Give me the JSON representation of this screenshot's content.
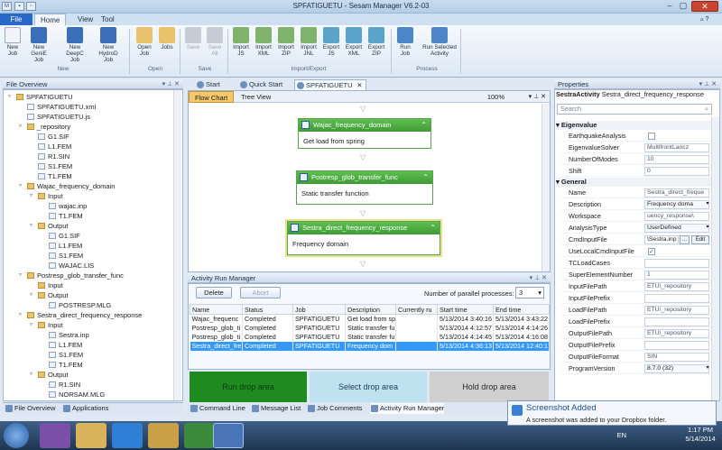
{
  "window": {
    "title": "SPFATIGUETU - Sesam Manager V6.2-03"
  },
  "ribbon_tabs": [
    "File",
    "Home",
    "View",
    "Tool"
  ],
  "ribbon": {
    "new": [
      {
        "l1": "New",
        "l2": "Job"
      },
      {
        "l1": "New",
        "l2": "GeniE Job"
      },
      {
        "l1": "New",
        "l2": "DeepC Job"
      },
      {
        "l1": "New",
        "l2": "HydroD Job"
      }
    ],
    "open": [
      {
        "l1": "Open",
        "l2": "Job"
      },
      {
        "l1": "Jobs",
        "l2": ""
      }
    ],
    "save": [
      {
        "l1": "Save",
        "l2": ""
      },
      {
        "l1": "Save",
        "l2": "All"
      }
    ],
    "impexp": [
      {
        "l1": "Import",
        "l2": "JS"
      },
      {
        "l1": "Import",
        "l2": "XML"
      },
      {
        "l1": "Import",
        "l2": "ZIP"
      },
      {
        "l1": "Import",
        "l2": "JNL"
      },
      {
        "l1": "Export",
        "l2": "JS"
      },
      {
        "l1": "Export",
        "l2": "XML"
      },
      {
        "l1": "Export",
        "l2": "ZIP"
      }
    ],
    "process": [
      {
        "l1": "Run",
        "l2": "Job"
      },
      {
        "l1": "Run Selected",
        "l2": "Activity"
      }
    ],
    "groups": [
      "New",
      "Open",
      "Save",
      "Import/Export",
      "Process"
    ]
  },
  "file_overview": {
    "title": "File Overview",
    "tree": [
      {
        "label": "SPFATIGUETU",
        "kind": "folder",
        "depth": 0,
        "exp": "-"
      },
      {
        "label": "SPFATIGUETU.xml",
        "kind": "file",
        "depth": 1
      },
      {
        "label": "SPFATIGUETU.js",
        "kind": "file",
        "depth": 1
      },
      {
        "label": "_repository",
        "kind": "folder",
        "depth": 1,
        "exp": "-"
      },
      {
        "label": "G1.SIF",
        "kind": "file",
        "depth": 2
      },
      {
        "label": "L1.FEM",
        "kind": "file",
        "depth": 2
      },
      {
        "label": "R1.SIN",
        "kind": "file",
        "depth": 2
      },
      {
        "label": "S1.FEM",
        "kind": "file",
        "depth": 2
      },
      {
        "label": "T1.FEM",
        "kind": "file",
        "depth": 2
      },
      {
        "label": "Wajac_frequency_domain",
        "kind": "folder",
        "depth": 1,
        "exp": "-"
      },
      {
        "label": "Input",
        "kind": "folder",
        "depth": 2,
        "exp": "-"
      },
      {
        "label": "wajac.inp",
        "kind": "file",
        "depth": 3
      },
      {
        "label": "T1.FEM",
        "kind": "file",
        "depth": 3
      },
      {
        "label": "Output",
        "kind": "folder",
        "depth": 2,
        "exp": "-"
      },
      {
        "label": "G1.SIF",
        "kind": "file",
        "depth": 3
      },
      {
        "label": "L1.FEM",
        "kind": "file",
        "depth": 3
      },
      {
        "label": "S1.FEM",
        "kind": "file",
        "depth": 3
      },
      {
        "label": "WAJAC.LIS",
        "kind": "file",
        "depth": 3
      },
      {
        "label": "Postresp_glob_transfer_func",
        "kind": "folder",
        "depth": 1,
        "exp": "-"
      },
      {
        "label": "Input",
        "kind": "folder",
        "depth": 2
      },
      {
        "label": "Output",
        "kind": "folder",
        "depth": 2,
        "exp": "-"
      },
      {
        "label": "POSTRESP.MLG",
        "kind": "file",
        "depth": 3
      },
      {
        "label": "Sestra_direct_frequency_response",
        "kind": "folder",
        "depth": 1,
        "exp": "-"
      },
      {
        "label": "Input",
        "kind": "folder",
        "depth": 2,
        "exp": "-"
      },
      {
        "label": "Sestra.inp",
        "kind": "file",
        "depth": 3
      },
      {
        "label": "L1.FEM",
        "kind": "file",
        "depth": 3
      },
      {
        "label": "S1.FEM",
        "kind": "file",
        "depth": 3
      },
      {
        "label": "T1.FEM",
        "kind": "file",
        "depth": 3
      },
      {
        "label": "Output",
        "kind": "folder",
        "depth": 2,
        "exp": "-"
      },
      {
        "label": "R1.SIN",
        "kind": "file",
        "depth": 3
      },
      {
        "label": "NORSAM.MLG",
        "kind": "file",
        "depth": 3
      }
    ],
    "bottom_tabs": [
      "File Overview",
      "Applications"
    ]
  },
  "doc_tabs": [
    "Start",
    "Quick Start",
    "SPFATIGUETU"
  ],
  "flow": {
    "tabs": [
      "Flow Chart",
      "Tree View"
    ],
    "zoom": "100%",
    "activities": [
      {
        "name": "Wajac_frequency_domain",
        "desc": "Get load from spring"
      },
      {
        "name": "Postresp_glob_transfer_func",
        "desc": "Static transfer function"
      },
      {
        "name": "Sestra_direct_frequency_response",
        "desc": "Frequency domain"
      }
    ]
  },
  "arm": {
    "title": "Activity Run Manager",
    "delete": "Delete",
    "abort": "Abort",
    "parallel_label": "Number of parallel processes:",
    "parallel_value": "3",
    "columns": [
      "Name",
      "Status",
      "Job",
      "Description",
      "Currently ru",
      "Start time",
      "End time"
    ],
    "rows": [
      [
        "Wajac_frequenc",
        "Completed",
        "SPFATIGUETU",
        "Get load from sp",
        "",
        "5/13/2014 3:40:16",
        "5/13/2014 3:43:22"
      ],
      [
        "Postresp_glob_ti",
        "Completed",
        "SPFATIGUETU",
        "Static transfer fu",
        "",
        "5/13/2014 4:12:57",
        "5/13/2014 4:14:26"
      ],
      [
        "Postresp_glob_ti",
        "Completed",
        "SPFATIGUETU",
        "Static transfer fu",
        "",
        "5/13/2014 4:14:45",
        "5/13/2014 4:16:08"
      ],
      [
        "Sestra_direct_fre",
        "Completed",
        "SPFATIGUETU",
        "Frequency dom",
        "",
        "5/13/2014 4:36:13",
        "5/13/2014 12:40:1"
      ]
    ],
    "selected_row": 3,
    "drop": {
      "run": "Run drop area",
      "select": "Select drop area",
      "hold": "Hold drop area"
    },
    "bottom_tabs": [
      "Command Line",
      "Message List",
      "Job Comments",
      "Activity Run Manager"
    ]
  },
  "properties": {
    "title": "Properties",
    "object_type": "SestraActivity",
    "object_name": "Sestra_direct_frequency_response",
    "search_placeholder": "Search",
    "categories": [
      {
        "name": "Eigenvalue",
        "rows": [
          {
            "n": "EarthquakeAnalysis",
            "t": "check",
            "v": ""
          },
          {
            "n": "EigenvalueSolver",
            "t": "val",
            "v": "MultifrontLancz"
          },
          {
            "n": "NumberOfModes",
            "t": "val",
            "v": "10"
          },
          {
            "n": "Shift",
            "t": "val",
            "v": "0"
          }
        ]
      },
      {
        "name": "General",
        "rows": [
          {
            "n": "Name",
            "t": "val",
            "v": "Sestra_direct_freque"
          },
          {
            "n": "Description",
            "t": "sel",
            "v": "Frequency doma"
          },
          {
            "n": "Workspace",
            "t": "val",
            "v": "uency_response\\"
          },
          {
            "n": "AnalysisType",
            "t": "sel",
            "v": "UserDefined"
          },
          {
            "n": "CmdInputFile",
            "t": "file",
            "v": "\\Sestra.inp",
            "e": "Edit"
          },
          {
            "n": "UseLocalCmdInputFile",
            "t": "check",
            "v": "✓"
          },
          {
            "n": "TCLoadCases",
            "t": "val",
            "v": ""
          },
          {
            "n": "SuperElementNumber",
            "t": "val",
            "v": "1"
          },
          {
            "n": "InputFilePath",
            "t": "val",
            "v": "ETU\\_repository"
          },
          {
            "n": "InputFilePrefix",
            "t": "val",
            "v": ""
          },
          {
            "n": "LoadFilePath",
            "t": "val",
            "v": "ETU\\_repository"
          },
          {
            "n": "LoadFilePrefix",
            "t": "val",
            "v": ""
          },
          {
            "n": "OutputFilePath",
            "t": "val",
            "v": "ETU\\_repository"
          },
          {
            "n": "OutputFilePrefix",
            "t": "val",
            "v": ""
          },
          {
            "n": "OutputFileFormat",
            "t": "val",
            "v": "SIN"
          },
          {
            "n": "ProgramVersion",
            "t": "sel",
            "v": "8.7.0 (32)"
          }
        ]
      }
    ]
  },
  "toast": {
    "title": "Screenshot Added",
    "message": "A screenshot was added to your Dropbox folder."
  },
  "tray": {
    "lang": "EN",
    "time": "1:17 PM",
    "date": "5/14/2014"
  },
  "colors": {
    "accent": "#2a68c8",
    "activity_green": "#3f9a35",
    "run_drop": "#1f8a1f",
    "select_drop": "#bfe2f0",
    "hold_drop": "#cfcfcf",
    "selection": "#3399ff"
  }
}
